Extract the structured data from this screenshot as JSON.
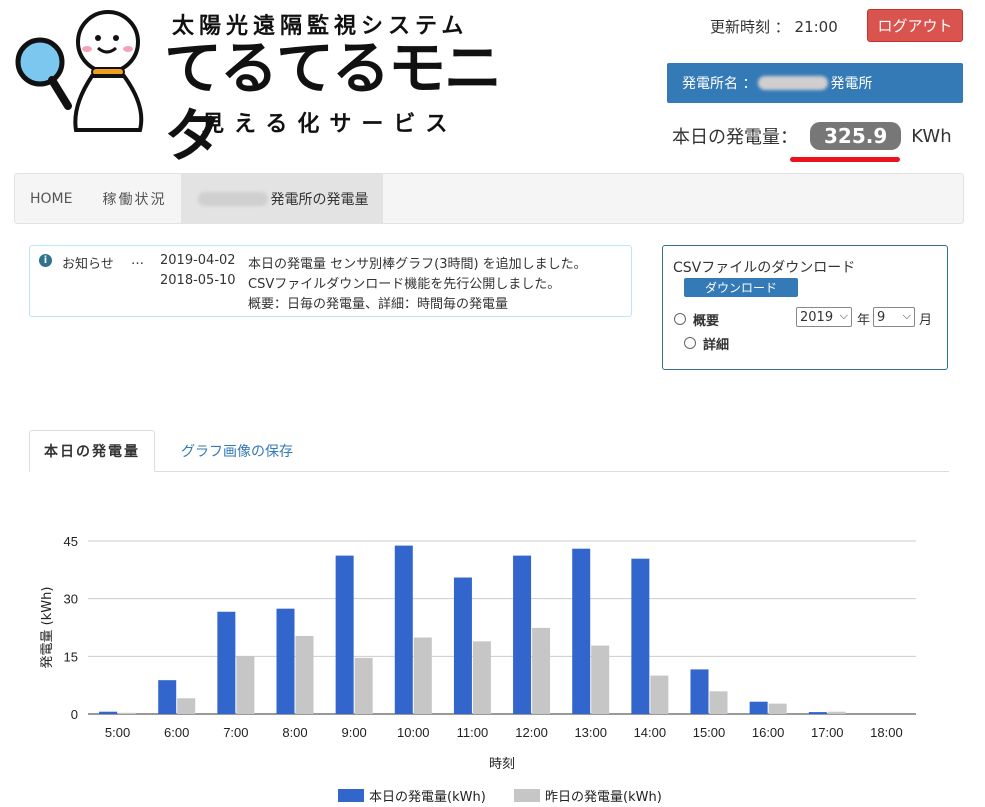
{
  "header": {
    "logo_subtitle_top": "太陽光遠隔監視システム",
    "logo_title": "てるてるモニタ",
    "logo_subtitle_bottom": "見える化サービス",
    "update_time": "更新時刻 ： 21:00",
    "logout_label": "ログアウト",
    "plant_label": "発電所名 ：",
    "plant_suffix": "発電所",
    "today_label": "本日の発電量：",
    "today_value": "325.9",
    "today_unit": "KWh"
  },
  "nav": {
    "home": "HOME",
    "status": "稼働状況",
    "current_suffix": "発電所の発電量"
  },
  "notice": {
    "label": "お知らせ",
    "dots": "…",
    "items": [
      {
        "date": "2019-04-02",
        "text": "本日の発電量 センサ別棒グラフ(3時間) を追加しました。"
      },
      {
        "date": "2018-05-10",
        "text": "CSVファイルダウンロード機能を先行公開しました。"
      },
      {
        "date": "",
        "text": "概要：日毎の発電量、詳細：時間毎の発電量"
      }
    ]
  },
  "csv": {
    "title": "CSVファイルのダウンロード",
    "download_label": "ダウンロード",
    "summary_label": "概要",
    "detail_label": "詳細",
    "year_value": "2019",
    "year_unit": "年",
    "month_value": "9",
    "month_unit": "月"
  },
  "tabs": {
    "today": "本日の発電量",
    "save": "グラフ画像の保存"
  },
  "colors": {
    "today": "#3366cc",
    "yesterday": "#c6c6c6"
  },
  "chart_data": {
    "type": "bar",
    "title": "",
    "xlabel": "時刻",
    "ylabel": "発電量 (kWh)",
    "ylim": [
      0,
      45
    ],
    "yticks": [
      0,
      15,
      30,
      45
    ],
    "grid": true,
    "legend": "bottom",
    "categories": [
      "5:00",
      "6:00",
      "7:00",
      "8:00",
      "9:00",
      "10:00",
      "11:00",
      "12:00",
      "13:00",
      "14:00",
      "15:00",
      "16:00",
      "17:00",
      "18:00"
    ],
    "series": [
      {
        "name": "本日の発電量(kWh)",
        "values": [
          0.6,
          8.8,
          26.6,
          27.4,
          41.2,
          43.8,
          35.5,
          41.2,
          43.0,
          40.4,
          11.6,
          3.2,
          0.5,
          0
        ]
      },
      {
        "name": "昨日の発電量(kWh)",
        "values": [
          0.3,
          4.1,
          15.1,
          20.3,
          14.6,
          19.9,
          18.9,
          22.4,
          17.8,
          10.0,
          5.9,
          2.7,
          0.6,
          0
        ]
      }
    ]
  }
}
